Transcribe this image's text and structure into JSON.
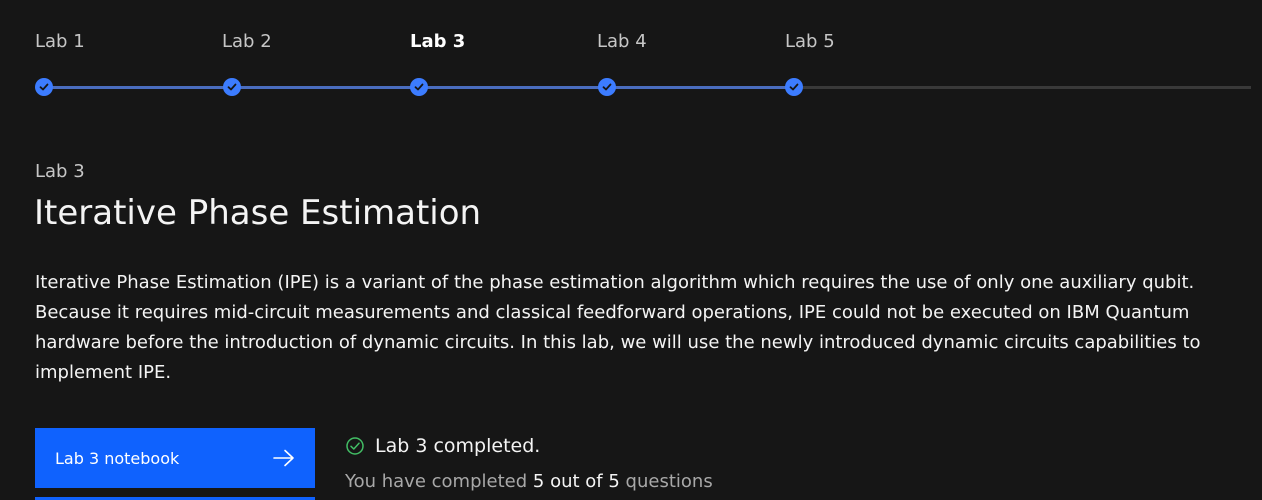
{
  "stepper": {
    "steps": [
      {
        "label": "Lab 1",
        "status": "completed",
        "current": false
      },
      {
        "label": "Lab 2",
        "status": "completed",
        "current": false
      },
      {
        "label": "Lab 3",
        "status": "completed",
        "current": true
      },
      {
        "label": "Lab 4",
        "status": "completed",
        "current": false
      },
      {
        "label": "Lab 5",
        "status": "completed",
        "current": false
      }
    ],
    "step_icon": "checkmark-circle-icon"
  },
  "lab": {
    "eyebrow": "Lab 3",
    "title": "Iterative Phase Estimation",
    "description": "Iterative Phase Estimation (IPE) is a variant of the phase estimation algorithm which requires the use of only one auxiliary qubit. Because it requires mid-circuit measurements and classical feedforward operations, IPE could not be executed on IBM Quantum hardware before the introduction of dynamic circuits. In this lab, we will use the newly introduced dynamic circuits capabilities to implement IPE."
  },
  "actions": {
    "notebook_label": "Lab 3 notebook",
    "notebook_icon": "arrow-right-icon"
  },
  "status": {
    "icon": "checkmark-outline-icon",
    "completed_text": "Lab 3 completed.",
    "progress_prefix": "You have completed",
    "completed_count": "5",
    "out_of_text": "out of",
    "total_count": "5",
    "progress_suffix": "questions"
  },
  "colors": {
    "background": "#161616",
    "accent": "#0f62fe",
    "step_dot": "#3c7cff",
    "success": "#42be65",
    "muted_text": "#a8a8a8"
  }
}
